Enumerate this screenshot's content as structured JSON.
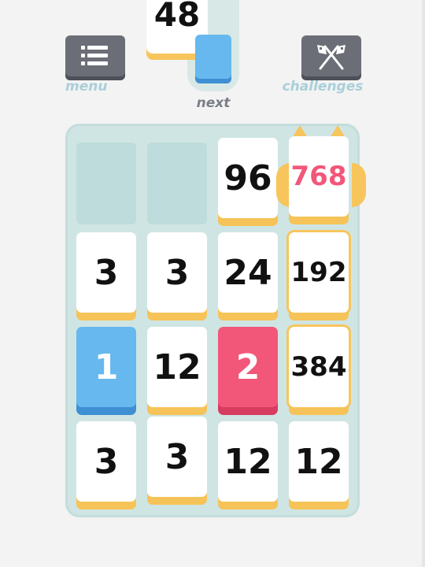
{
  "header": {
    "menu_label": "menu",
    "challenges_label": "challenges",
    "next_label": "next",
    "sliding_tile_value": "48"
  },
  "board": {
    "rows": [
      [
        "",
        "",
        "96",
        "768"
      ],
      [
        "3",
        "3",
        "24",
        "192"
      ],
      [
        "1",
        "12",
        "2",
        "384"
      ],
      [
        "3",
        "3",
        "12",
        "12"
      ]
    ]
  },
  "colors": {
    "white_tile": "#ffffff",
    "one_tile": "#66b8ee",
    "two_tile": "#f2577a",
    "tile_shadow": "#f6c358",
    "board_bg": "#cfe5e4",
    "button_bg": "#6b6e76",
    "label_teal": "#a9cfd9"
  },
  "icons": {
    "menu": "list-icon",
    "challenges": "crossed-flags-icon"
  }
}
